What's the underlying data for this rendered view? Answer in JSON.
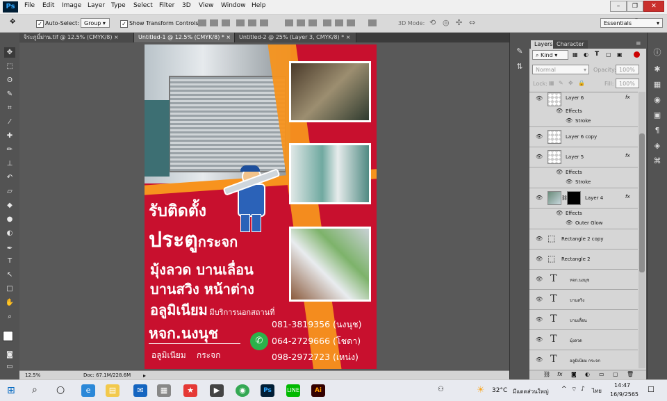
{
  "app": {
    "logo": "Ps",
    "menu": [
      "File",
      "Edit",
      "Image",
      "Layer",
      "Type",
      "Select",
      "Filter",
      "3D",
      "View",
      "Window",
      "Help"
    ],
    "window_controls": {
      "minimize": "–",
      "restore": "❐",
      "close": "✕"
    },
    "secondary_controls": {
      "minimize": "–",
      "restore": "❐",
      "close": "✕"
    }
  },
  "options": {
    "auto_select_label": "Auto-Select:",
    "auto_select_checked": "✓",
    "auto_select_value": "Group",
    "show_transform_label": "Show Transform Controls",
    "show_transform_checked": "✓",
    "mode_3d_label": "3D Mode:",
    "workspace": "Essentials"
  },
  "tabs": [
    {
      "label": "จิระภูมิ์ม่าน.tif @ 12.5% (CMYK/8)",
      "close": "×"
    },
    {
      "label": "Untitled-1 @ 12.5% (CMYK/8) *",
      "close": "×"
    },
    {
      "label": "Untitled-2 @ 25% (Layer 3, CMYK/8) *",
      "close": "×"
    }
  ],
  "status": {
    "zoom": "12.5%",
    "doc": "Doc: 67.1M/228.6M"
  },
  "panels": {
    "tab_layers": "Layers",
    "tab_character": "Character",
    "kind_label": "Kind",
    "blend_mode": "Normal",
    "opacity_label": "Opacity:",
    "opacity_value": "100%",
    "lock_label": "Lock:",
    "fill_label": "Fill:",
    "fill_value": "100%"
  },
  "layers": [
    {
      "name": "Layer 6",
      "type": "raster",
      "fx": "fx"
    },
    {
      "name": "Effects",
      "type": "effects"
    },
    {
      "name": "Stroke",
      "type": "effect"
    },
    {
      "name": "Layer 6 copy",
      "type": "raster"
    },
    {
      "name": "Layer 5",
      "type": "raster",
      "fx": "fx"
    },
    {
      "name": "Effects",
      "type": "effects"
    },
    {
      "name": "Stroke",
      "type": "effect"
    },
    {
      "name": "Layer 4",
      "type": "masked",
      "fx": "fx"
    },
    {
      "name": "Effects",
      "type": "effects"
    },
    {
      "name": "Outer Glow",
      "type": "effect"
    },
    {
      "name": "Rectangle 2 copy",
      "type": "shape"
    },
    {
      "name": "Rectangle 2",
      "type": "shape"
    },
    {
      "name": "หจก.นงนุช",
      "type": "text"
    },
    {
      "name": "บานสวิง",
      "type": "text"
    },
    {
      "name": "บานเลื่อน",
      "type": "text"
    },
    {
      "name": "มุ้งลวด",
      "type": "text"
    },
    {
      "name": "อลูมิเนียม กระจก",
      "type": "text"
    }
  ],
  "poster": {
    "line1": "รับติดตั้ง",
    "line2a": "ประตู",
    "line2b": "กระจก",
    "line3": "มุ้งลวด บานเลื่อน",
    "line4": "บานสวิง หน้าต่าง",
    "line5a": "อลูมิเนียม",
    "line5b": "มีบริการนอกสถานที่",
    "company": "หจก.นงนุช",
    "company_sub": "อลูมิเนียม    กระจก",
    "phones": [
      "081-3819356 (นงนุช)",
      "064-2729666 (โชดา)",
      "098-2972723 (เหน่ง)"
    ]
  },
  "taskbar": {
    "weather": "32°C",
    "weather_text": "มีแดดส่วนใหญ่",
    "lang": "ไทย",
    "time": "14:47",
    "date": "16/9/2565"
  }
}
